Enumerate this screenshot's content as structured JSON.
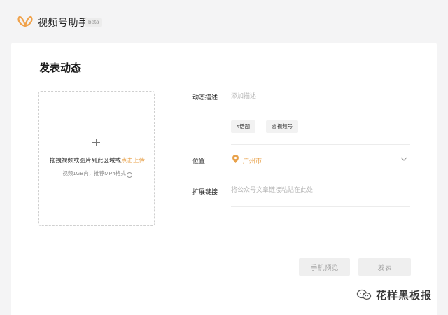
{
  "header": {
    "app_title": "视频号助手",
    "badge": "beta",
    "logo_icon": "butterfly-logo-icon",
    "brand_color": "#f0a24b"
  },
  "main": {
    "page_title": "发表动态",
    "upload": {
      "instruction_prefix": "拖拽视频或图片到此区域或",
      "instruction_link": "点击上传",
      "hint": "视频1GB内，推荐MP4格式",
      "icon": "plus-icon"
    },
    "form": {
      "description": {
        "label": "动态描述",
        "placeholder": "添加描述",
        "value": ""
      },
      "tags": {
        "topic_button": "#话题",
        "mention_button": "@视频号"
      },
      "location": {
        "label": "位置",
        "value": "广州市",
        "icon": "location-pin-icon",
        "dropdown_icon": "chevron-down-icon"
      },
      "extended_link": {
        "label": "扩展链接",
        "placeholder": "将公众号文章链接粘贴在此处",
        "value": ""
      }
    },
    "actions": {
      "preview_button": "手机预览",
      "publish_button": "发表"
    }
  },
  "watermark": {
    "text": "花样黑板报",
    "icon": "wechat-icon"
  },
  "colors": {
    "accent": "#e8a14a",
    "page_background": "#f4f4f5",
    "card_background": "#ffffff",
    "disabled_button": "#efefef"
  }
}
